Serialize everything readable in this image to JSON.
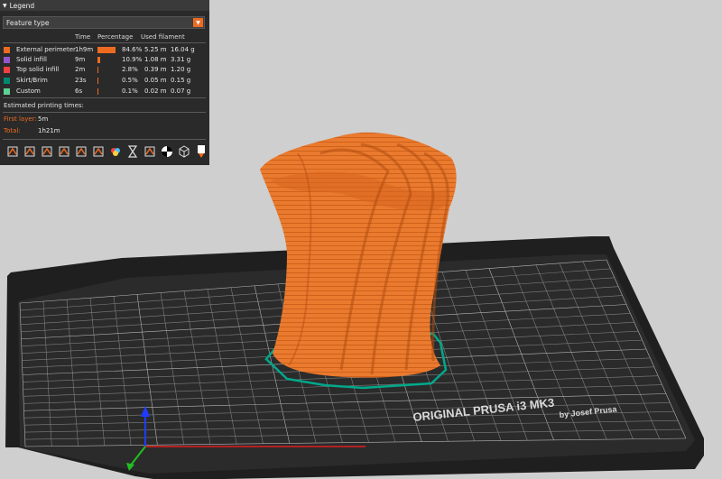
{
  "legend": {
    "title": "Legend",
    "view_type": "Feature type",
    "headers": {
      "time": "Time",
      "percentage": "Percentage",
      "used_filament": "Used filament"
    },
    "features": [
      {
        "name": "External perimeter",
        "time": "1h9m",
        "percentage_text": "84.6%",
        "percentage": 84.6,
        "length": "5.25 m",
        "weight": "16.04 g",
        "color": "#ed6b21"
      },
      {
        "name": "Solid infill",
        "time": "9m",
        "percentage_text": "10.9%",
        "percentage": 10.9,
        "length": "1.08 m",
        "weight": "3.31 g",
        "color": "#9654cc"
      },
      {
        "name": "Top solid infill",
        "time": "2m",
        "percentage_text": "2.8%",
        "percentage": 2.8,
        "length": "0.39 m",
        "weight": "1.20 g",
        "color": "#f04040"
      },
      {
        "name": "Skirt/Brim",
        "time": "23s",
        "percentage_text": "0.5%",
        "percentage": 0.5,
        "length": "0.05 m",
        "weight": "0.15 g",
        "color": "#00876e"
      },
      {
        "name": "Custom",
        "time": "6s",
        "percentage_text": "0.1%",
        "percentage": 0.1,
        "length": "0.02 m",
        "weight": "0.07 g",
        "color": "#5ed194"
      }
    ],
    "estimated_label": "Estimated printing times:",
    "first_layer_label": "First layer:",
    "first_layer_value": "5m",
    "total_label": "Total:",
    "total_value": "1h21m"
  },
  "toolbar_icons": [
    "travel-icon",
    "wipe-icon",
    "retractions-icon",
    "deretractions-icon",
    "seams-icon",
    "tool-changes-icon",
    "color-changes-icon",
    "pause-icon",
    "custom-gcode-icon",
    "center-of-gravity-icon",
    "shells-icon",
    "tool-marker-icon"
  ],
  "bed": {
    "brand_text": "ORIGINAL PRUSA i3  MK3",
    "sub_text": "by Josef Prusa"
  },
  "colors": {
    "accent": "#ed6b21",
    "background": "#cfcfcf",
    "bed": "#2a2a2a",
    "grid": "#8c8c8c"
  }
}
